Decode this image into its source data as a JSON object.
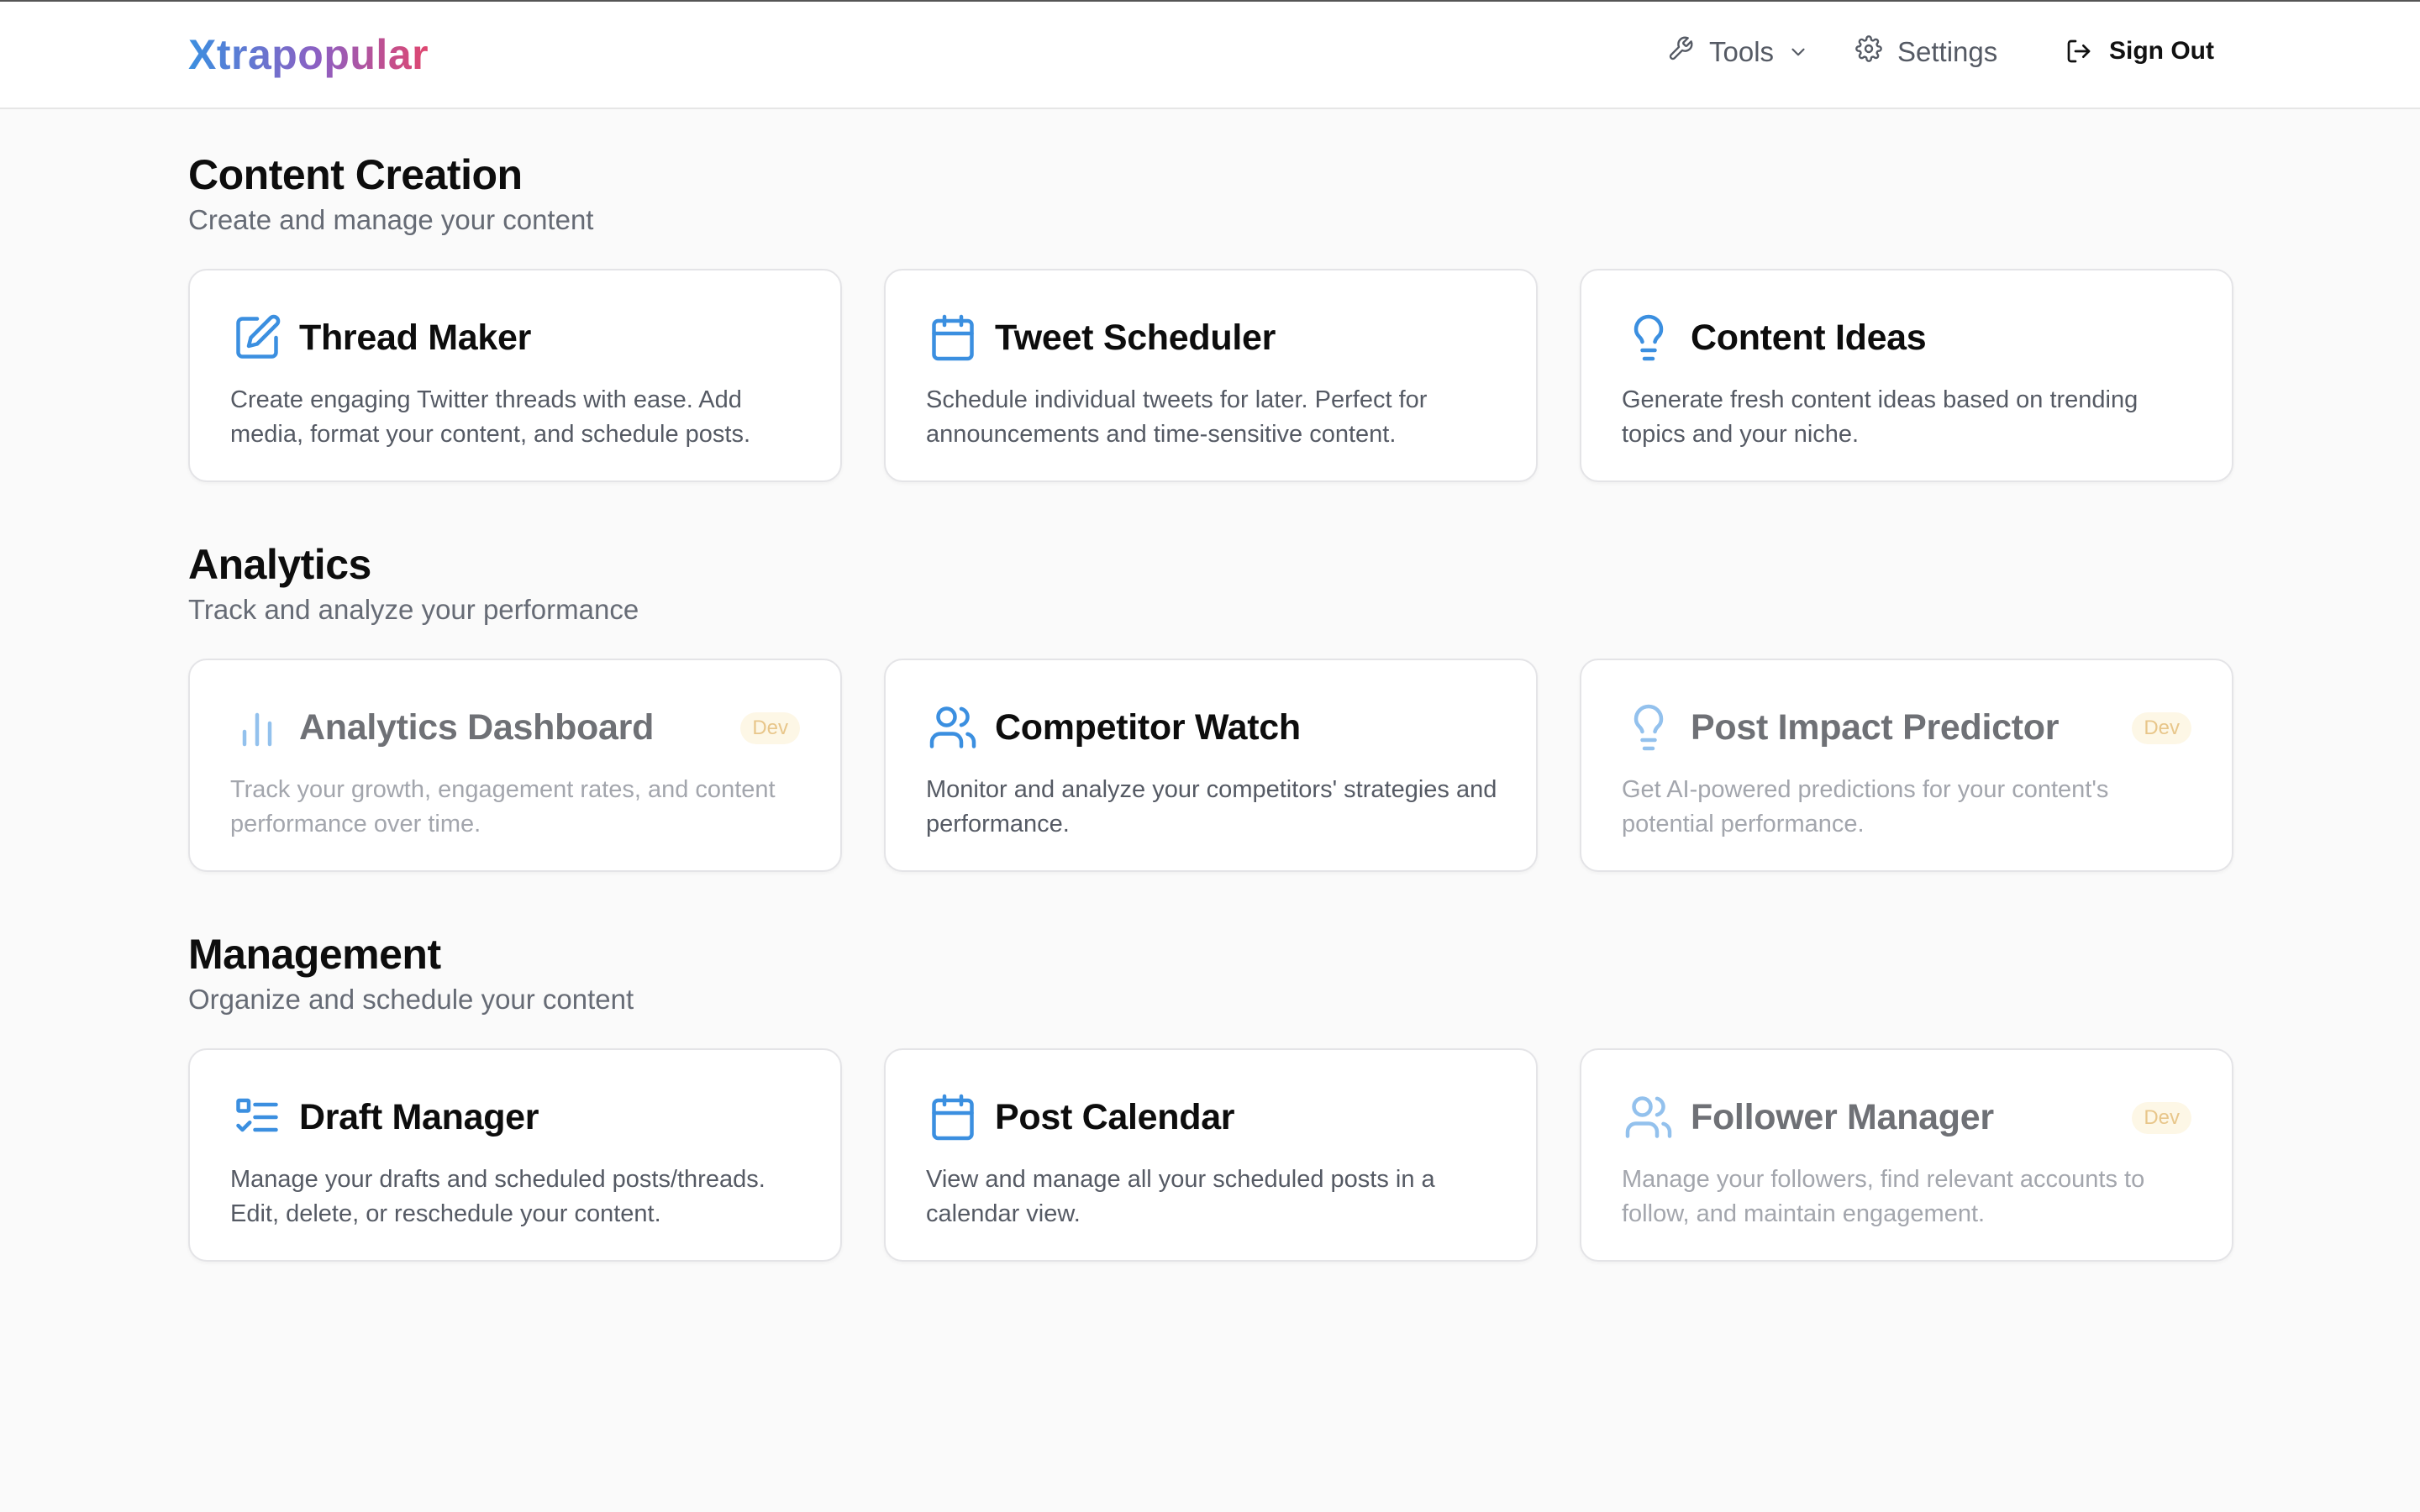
{
  "app": {
    "logo": "Xtrapopular"
  },
  "nav": {
    "tools_label": "Tools",
    "settings_label": "Settings",
    "signout_label": "Sign Out"
  },
  "colors": {
    "accent_blue": "#3b8fe0",
    "logo_gradient": [
      "#3b8fe0",
      "#8e5fc2",
      "#e0466f"
    ],
    "dev_badge_bg": "#fdf7e6",
    "dev_badge_text": "#e8c68a"
  },
  "sections": [
    {
      "title": "Content Creation",
      "subtitle": "Create and manage your content",
      "cards": [
        {
          "icon": "pencil-square-icon",
          "title": "Thread Maker",
          "desc": "Create engaging Twitter threads with ease. Add media, format your content, and schedule posts.",
          "dev": false
        },
        {
          "icon": "calendar-icon",
          "title": "Tweet Scheduler",
          "desc": "Schedule individual tweets for later. Perfect for announcements and time-sensitive content.",
          "dev": false
        },
        {
          "icon": "lightbulb-icon",
          "title": "Content Ideas",
          "desc": "Generate fresh content ideas based on trending topics and your niche.",
          "dev": false
        }
      ]
    },
    {
      "title": "Analytics",
      "subtitle": "Track and analyze your performance",
      "cards": [
        {
          "icon": "bar-chart-icon",
          "title": "Analytics Dashboard",
          "desc": "Track your growth, engagement rates, and content performance over time.",
          "dev": true,
          "badge": "Dev"
        },
        {
          "icon": "users-icon",
          "title": "Competitor Watch",
          "desc": "Monitor and analyze your competitors' strategies and performance.",
          "dev": false
        },
        {
          "icon": "lightbulb-icon",
          "title": "Post Impact Predictor",
          "desc": "Get AI-powered predictions for your content's potential performance.",
          "dev": true,
          "badge": "Dev"
        }
      ]
    },
    {
      "title": "Management",
      "subtitle": "Organize and schedule your content",
      "cards": [
        {
          "icon": "list-checks-icon",
          "title": "Draft Manager",
          "desc": "Manage your drafts and scheduled posts/threads. Edit, delete, or reschedule your content.",
          "dev": false
        },
        {
          "icon": "calendar-icon",
          "title": "Post Calendar",
          "desc": "View and manage all your scheduled posts in a calendar view.",
          "dev": false
        },
        {
          "icon": "users-icon",
          "title": "Follower Manager",
          "desc": "Manage your followers, find relevant accounts to follow, and maintain engagement.",
          "dev": true,
          "badge": "Dev"
        }
      ]
    }
  ]
}
